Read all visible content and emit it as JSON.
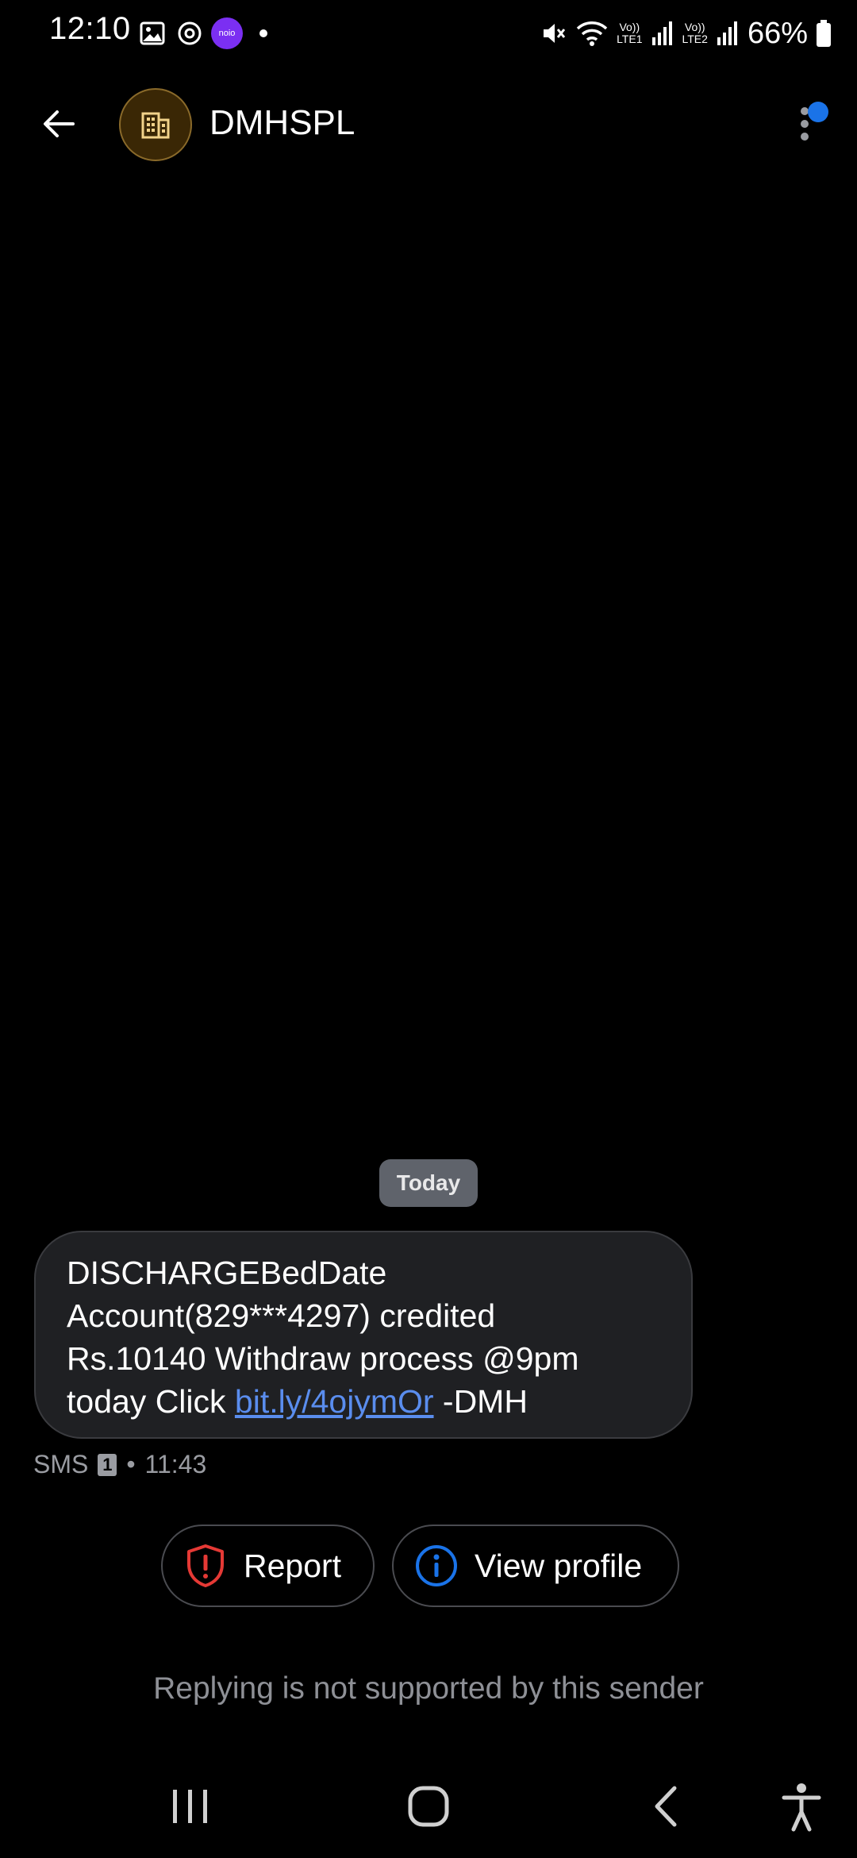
{
  "status_bar": {
    "time": "12:10",
    "battery": "66%",
    "icons": [
      "gallery-icon",
      "threads-icon",
      "app-icon",
      "dot-icon",
      "mute-icon",
      "wifi-icon",
      "volte-lte1-icon",
      "signal-icon",
      "volte-lte2-icon",
      "signal-icon",
      "battery-icon"
    ],
    "app_badge": "noio",
    "lte1": "LTE1",
    "lte2": "LTE2",
    "vol": "Vo))"
  },
  "header": {
    "title": "DMHSPL",
    "avatar_icon": "building-icon"
  },
  "conversation": {
    "date_label": "Today",
    "message": {
      "line1": "DISCHARGEBedDate",
      "line2": "Account(829***4297) credited",
      "line3": "Rs.10140 Withdraw process @9pm",
      "line4_prefix": "today Click ",
      "link": "bit.ly/4ojymOr",
      "line4_suffix": " -DMH"
    },
    "meta": {
      "type": "SMS",
      "sim": "1",
      "separator": "•",
      "time": "11:43"
    }
  },
  "actions": {
    "report_label": "Report",
    "view_profile_label": "View profile"
  },
  "footer_note": "Replying is not supported by this sender",
  "colors": {
    "accent": "#1a73e8",
    "report_red": "#e53935",
    "link_blue": "#5a8dee"
  }
}
